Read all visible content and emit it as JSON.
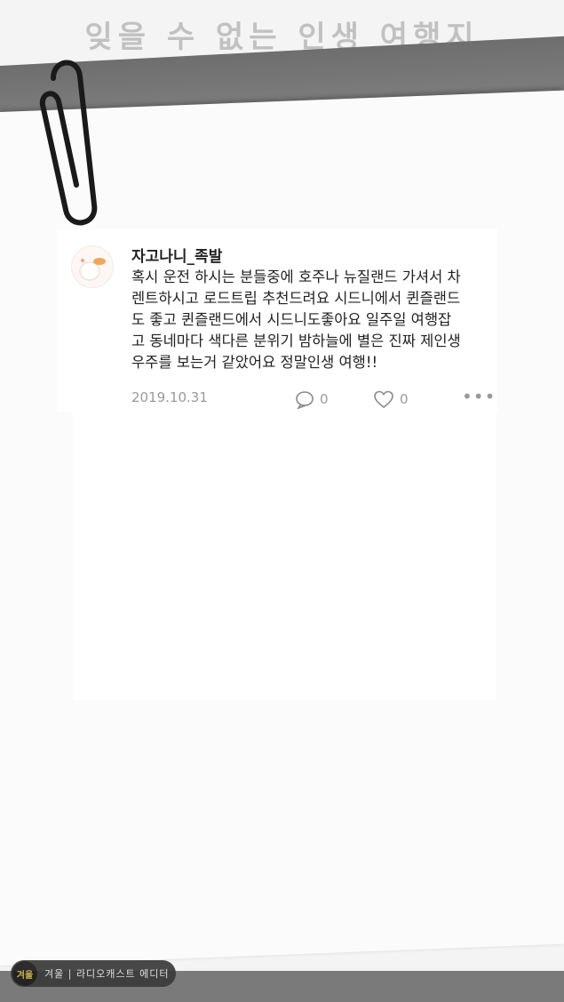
{
  "banner": {
    "title": "잊을 수 없는 인생 여행지"
  },
  "post": {
    "username": "자고나니_족발",
    "text": "혹시 운전 하시는 분들중에 호주나 뉴질랜드 가셔서 차\n렌트하시고 로드트립 추천드려요 시드니에서 퀸즐랜드\n도 좋고 퀸즐랜드에서 시드니도좋아요 일주일 여행잡\n고 동네마다 색다른 분위기 밤하늘에 별은 진짜 제인생\n우주를 보는거 같았어요 정말인생 여행!!",
    "date": "2019.10.31",
    "comment_count": "0",
    "like_count": "0",
    "more": "•••"
  },
  "watermark": {
    "logo": "겨울",
    "text": "겨울 | 라디오캐스트 에디터"
  }
}
